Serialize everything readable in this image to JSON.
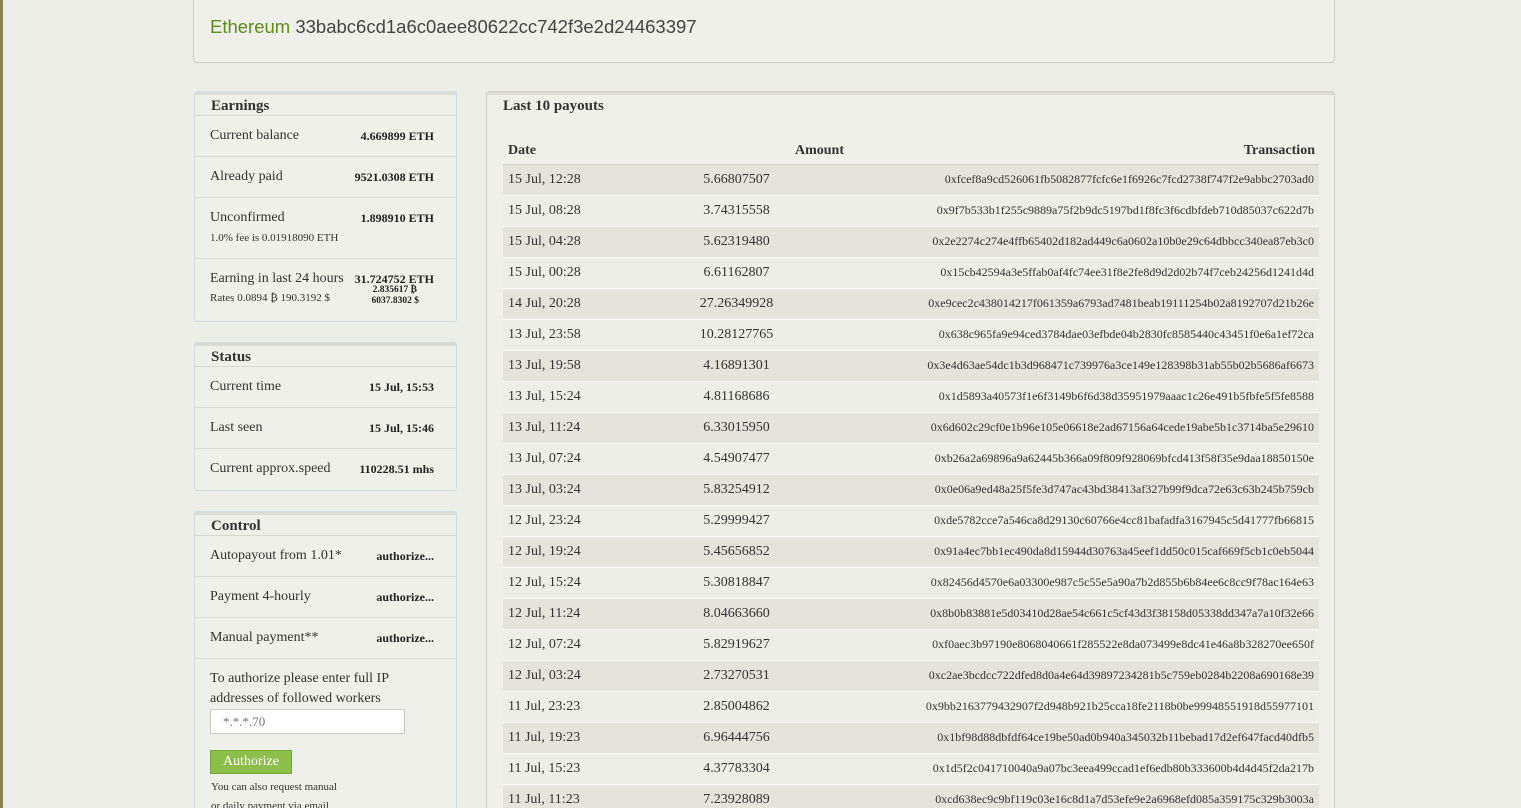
{
  "header": {
    "coin": "Ethereum",
    "address": "33babc6cd1a6c0aee80622cc742f3e2d24463397"
  },
  "earnings": {
    "title": "Earnings",
    "current_balance_label": "Current balance",
    "current_balance_value": "4.669899 ETH",
    "already_paid_label": "Already paid",
    "already_paid_value": "9521.0308 ETH",
    "unconfirmed_label": "Unconfirmed",
    "unconfirmed_value": "1.898910 ETH",
    "fee_note": "1.0% fee is 0.01918090 ETH",
    "last24_label": "Earning in last 24 hours",
    "last24_value": "31.724752 ETH",
    "last24_btc": "2.835617 ₿",
    "last24_usd": "6037.8302 $",
    "rates_note": "Rates 0.0894 ₿ 190.3192 $"
  },
  "status": {
    "title": "Status",
    "current_time_label": "Current time",
    "current_time_value": "15 Jul, 15:53",
    "last_seen_label": "Last seen",
    "last_seen_value": "15 Jul, 15:46",
    "speed_label": "Current approx.speed",
    "speed_value": "110228.51 mhs"
  },
  "control": {
    "title": "Control",
    "autopayout_label": "Autopayout from 1.01*",
    "payment_hourly_label": "Payment 4-hourly",
    "manual_payment_label": "Manual payment**",
    "authorize_link": "authorize...",
    "auth_instructions": "To authorize please enter full IP addresses of followed workers",
    "ip_placeholder": "*.*.*.70",
    "authorize_button": "Authorize",
    "note_line1": "You can also request manual",
    "note_line2": "or daily payment via email"
  },
  "payouts": {
    "title": "Last 10 payouts",
    "columns": {
      "date": "Date",
      "amount": "Amount",
      "transaction": "Transaction"
    },
    "rows": [
      {
        "date": "15 Jul, 12:28",
        "amount": "5.66807507",
        "tx": "0xfcef8a9cd526061fb5082877fcfc6e1f6926c7fcd2738f747f2e9abbc2703ad0"
      },
      {
        "date": "15 Jul, 08:28",
        "amount": "3.74315558",
        "tx": "0x9f7b533b1f255c9889a75f2b9dc5197bd1f8fc3f6cdbfdeb710d85037c622d7b"
      },
      {
        "date": "15 Jul, 04:28",
        "amount": "5.62319480",
        "tx": "0x2e2274c274e4ffb65402d182ad449c6a0602a10b0e29c64dbbcc340ea87eb3c0"
      },
      {
        "date": "15 Jul, 00:28",
        "amount": "6.61162807",
        "tx": "0x15cb42594a3e5ffab0af4fc74ee31f8e2fe8d9d2d02b74f7ceb24256d1241d4d"
      },
      {
        "date": "14 Jul, 20:28",
        "amount": "27.26349928",
        "tx": "0xe9cec2c438014217f061359a6793ad7481beab19111254b02a8192707d21b26e"
      },
      {
        "date": "13 Jul, 23:58",
        "amount": "10.28127765",
        "tx": "0x638c965fa9e94ced3784dae03efbde04b2830fc8585440c43451f0e6a1ef72ca"
      },
      {
        "date": "13 Jul, 19:58",
        "amount": "4.16891301",
        "tx": "0x3e4d63ae54dc1b3d968471c739976a3ce149e128398b31ab55b02b5686af6673"
      },
      {
        "date": "13 Jul, 15:24",
        "amount": "4.81168686",
        "tx": "0x1d5893a40573f1e6f3149b6f6d38d35951979aaac1c26e491b5fbfe5f5fe8588"
      },
      {
        "date": "13 Jul, 11:24",
        "amount": "6.33015950",
        "tx": "0x6d602c29cf0e1b96e105e06618e2ad67156a64cede19abe5b1c3714ba5e29610"
      },
      {
        "date": "13 Jul, 07:24",
        "amount": "4.54907477",
        "tx": "0xb26a2a69896a9a62445b366a09f809f928069bfcd413f58f35e9daa18850150e"
      },
      {
        "date": "13 Jul, 03:24",
        "amount": "5.83254912",
        "tx": "0x0e06a9ed48a25f5fe3d747ac43bd38413af327b99f9dca72e63c63b245b759cb"
      },
      {
        "date": "12 Jul, 23:24",
        "amount": "5.29999427",
        "tx": "0xde5782cce7a546ca8d29130c60766e4cc81bafadfa3167945c5d41777fb66815"
      },
      {
        "date": "12 Jul, 19:24",
        "amount": "5.45656852",
        "tx": "0x91a4ec7bb1ec490da8d15944d30763a45eef1dd50c015caf669f5cb1c0eb5044"
      },
      {
        "date": "12 Jul, 15:24",
        "amount": "5.30818847",
        "tx": "0x82456d4570e6a03300e987c5c55e5a90a7b2d855b6b84ee6c8cc9f78ac164e63"
      },
      {
        "date": "12 Jul, 11:24",
        "amount": "8.04663660",
        "tx": "0x8b0b83881e5d03410d28ae54c661c5cf43d3f38158d05338dd347a7a10f32e66"
      },
      {
        "date": "12 Jul, 07:24",
        "amount": "5.82919627",
        "tx": "0xf0aec3b97190e8068040661f285522e8da073499e8dc41e46a8b328270ee650f"
      },
      {
        "date": "12 Jul, 03:24",
        "amount": "2.73270531",
        "tx": "0xc2ae3bcdcc722dfed8d0a4e64d39897234281b5c759eb0284b2208a690168e39"
      },
      {
        "date": "11 Jul, 23:23",
        "amount": "2.85004862",
        "tx": "0x9bb2163779432907f2d948b921b25cca18fe2118b0be99948551918d55977101"
      },
      {
        "date": "11 Jul, 19:23",
        "amount": "6.96444756",
        "tx": "0x1bf98d88dbfdf64ce19be50ad0b940a345032b11bebad17d2ef647facd40dfb5"
      },
      {
        "date": "11 Jul, 15:23",
        "amount": "4.37783304",
        "tx": "0x1d5f2c041710040a9a07bc3eea499ccad1ef6edb80b333600b4d4d45f2da217b"
      },
      {
        "date": "11 Jul, 11:23",
        "amount": "7.23928089",
        "tx": "0xcd638ec9c9bf119c03e16c8d1a7d53efe9e2a6968efd085a359175c329b3003a"
      }
    ]
  }
}
